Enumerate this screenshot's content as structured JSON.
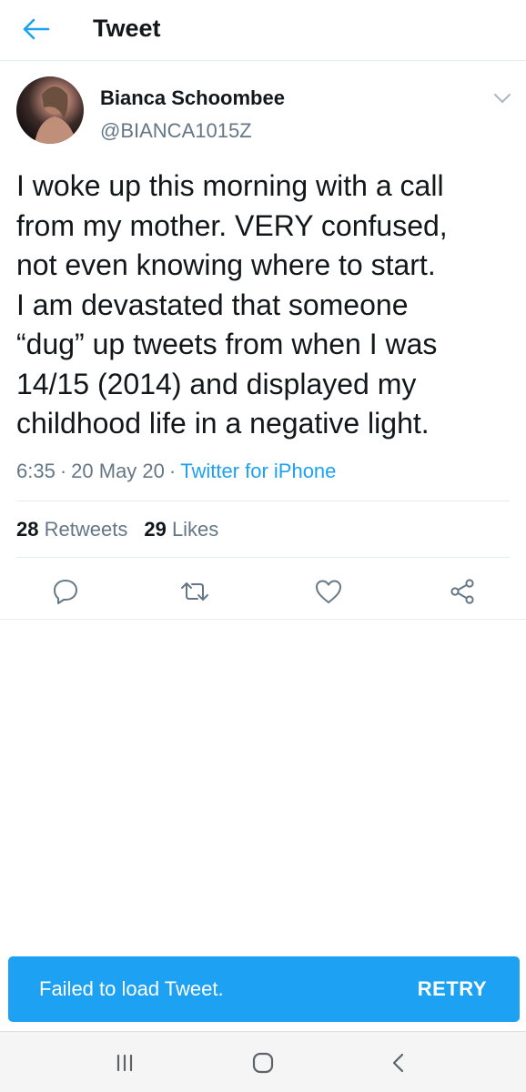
{
  "header": {
    "title": "Tweet",
    "back_icon": "arrow-left-icon"
  },
  "tweet": {
    "author": {
      "name": "Bianca Schoombee",
      "handle": "@BIANCA1015Z",
      "avatar": "profile-photo"
    },
    "text": "I woke up this morning with a call\nfrom my mother. VERY confused,\nnot even knowing where to start.\nI am devastated that someone\n“dug” up tweets from when I was\n14/15 (2014) and displayed my\nchildhood life in a negative light.",
    "time": "6:35",
    "date": "20 May 20",
    "separator": "·",
    "source": "Twitter for iPhone",
    "stats": {
      "retweets_count": "28",
      "retweets_label": "Retweets",
      "likes_count": "29",
      "likes_label": "Likes"
    },
    "actions": [
      "reply-icon",
      "retweet-icon",
      "like-icon",
      "share-icon"
    ]
  },
  "toast": {
    "message": "Failed to load Tweet.",
    "action": "RETRY"
  },
  "system_nav": {
    "buttons": [
      "recent-apps-icon",
      "home-icon",
      "back-icon"
    ]
  },
  "colors": {
    "accent": "#1da1f2",
    "text_primary": "#14171a",
    "text_secondary": "#657786",
    "divider": "#e6ecf0"
  }
}
